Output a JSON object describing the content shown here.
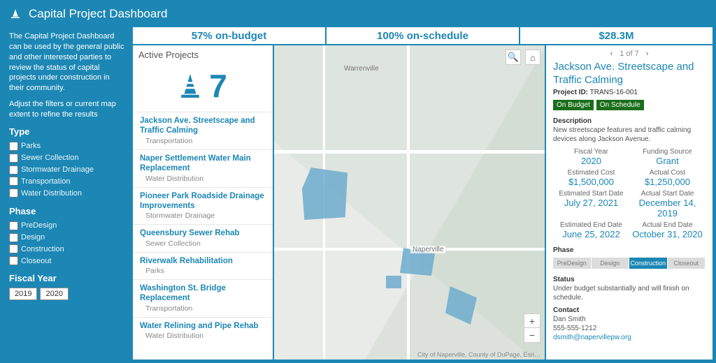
{
  "header": {
    "title": "Capital Project Dashboard"
  },
  "sidebar": {
    "intro": "The Capital Project Dashboard can be used by the general public and other interested parties to review the status of capital projects under construction in their community.",
    "hint": "Adjust the filters or current map extent to refine the results",
    "type_label": "Type",
    "types": [
      "Parks",
      "Sewer Collection",
      "Stormwater Drainage",
      "Transportation",
      "Water Distribution"
    ],
    "phase_label": "Phase",
    "phases": [
      "PreDesign",
      "Design",
      "Construction",
      "Closeout"
    ],
    "fy_label": "Fiscal Year",
    "fy_options": [
      "2019",
      "2020"
    ]
  },
  "kpis": {
    "budget": "57% on-budget",
    "schedule": "100% on-schedule",
    "total": "$28.3M"
  },
  "projects": {
    "header": "Active Projects",
    "count": "7",
    "list": [
      {
        "name": "Jackson Ave. Streetscape and Traffic Calming",
        "cat": "Transportation"
      },
      {
        "name": "Naper Settlement Water Main Replacement",
        "cat": "Water Distribution"
      },
      {
        "name": "Pioneer Park Roadside Drainage Improvements",
        "cat": "Stormwater Drainage"
      },
      {
        "name": "Queensbury Sewer Rehab",
        "cat": "Sewer Collection"
      },
      {
        "name": "Riverwalk Rehabilitation",
        "cat": "Parks"
      },
      {
        "name": "Washington St. Bridge Replacement",
        "cat": "Transportation"
      },
      {
        "name": "Water Relining and Pipe Rehab",
        "cat": "Water Distribution"
      }
    ]
  },
  "map": {
    "labels": {
      "center": "Naperville",
      "top": "Warrenville"
    },
    "attribution": "City of Naperville, County of DuPage, Esri…"
  },
  "detail": {
    "pager": "1 of 7",
    "title": "Jackson Ave. Streetscape and Traffic Calming",
    "pid_label": "Project ID:",
    "pid": "TRANS-16-001",
    "badge_budget": "On Budget",
    "badge_schedule": "On Schedule",
    "desc_label": "Description",
    "desc": "New streetscape features and traffic calming devices along Jackson Avenue.",
    "fields": {
      "fy_l": "Fiscal Year",
      "fy_v": "2020",
      "fund_l": "Funding Source",
      "fund_v": "Grant",
      "ec_l": "Estimated Cost",
      "ec_v": "$1,500,000",
      "ac_l": "Actual Cost",
      "ac_v": "$1,250,000",
      "esd_l": "Estimated Start Date",
      "esd_v": "July 27, 2021",
      "asd_l": "Actual Start Date",
      "asd_v": "December 14, 2019",
      "eed_l": "Estimated End Date",
      "eed_v": "June 25, 2022",
      "aed_l": "Actual End Date",
      "aed_v": "October 31, 2020"
    },
    "phase_label": "Phase",
    "phase_segs": [
      "PreDesign",
      "Design",
      "Construction",
      "Closeout"
    ],
    "phase_active": "Construction",
    "status_label": "Status",
    "status": "Under budget substantially and will finish on schedule.",
    "contact_label": "Contact",
    "contact_name": "Dan Smith",
    "contact_phone": "555-555-1212",
    "contact_email": "dsmith@napervillepw.org"
  }
}
